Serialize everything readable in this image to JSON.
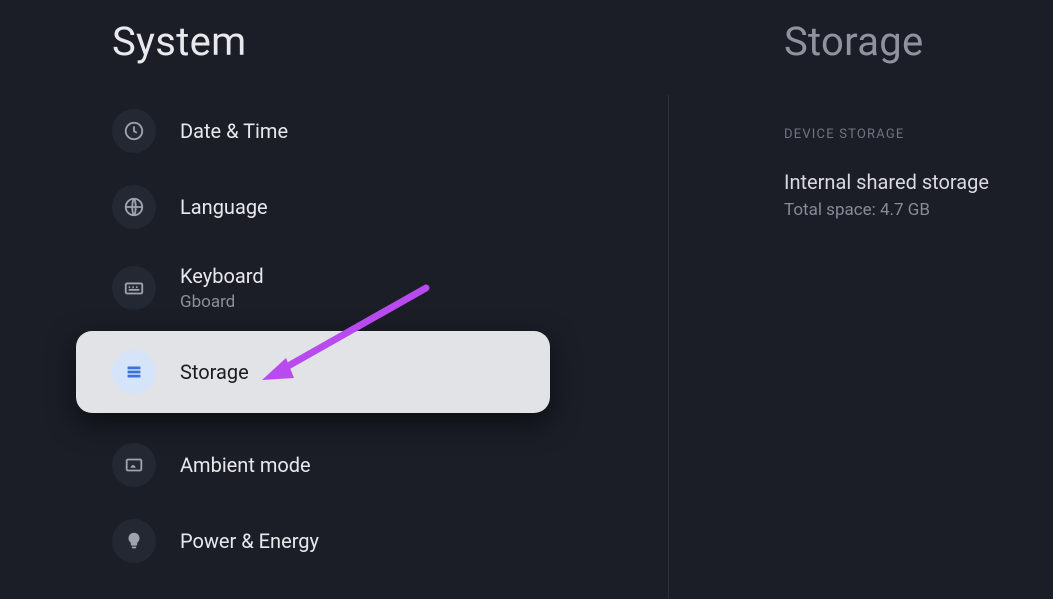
{
  "left": {
    "title": "System",
    "items": [
      {
        "label": "Date & Time",
        "sub": ""
      },
      {
        "label": "Language",
        "sub": ""
      },
      {
        "label": "Keyboard",
        "sub": "Gboard"
      },
      {
        "label": "Storage",
        "sub": ""
      },
      {
        "label": "Ambient mode",
        "sub": ""
      },
      {
        "label": "Power & Energy",
        "sub": ""
      }
    ]
  },
  "right": {
    "title": "Storage",
    "section_header": "DEVICE STORAGE",
    "storage_name": "Internal shared storage",
    "storage_sub": "Total space: 4.7 GB"
  }
}
